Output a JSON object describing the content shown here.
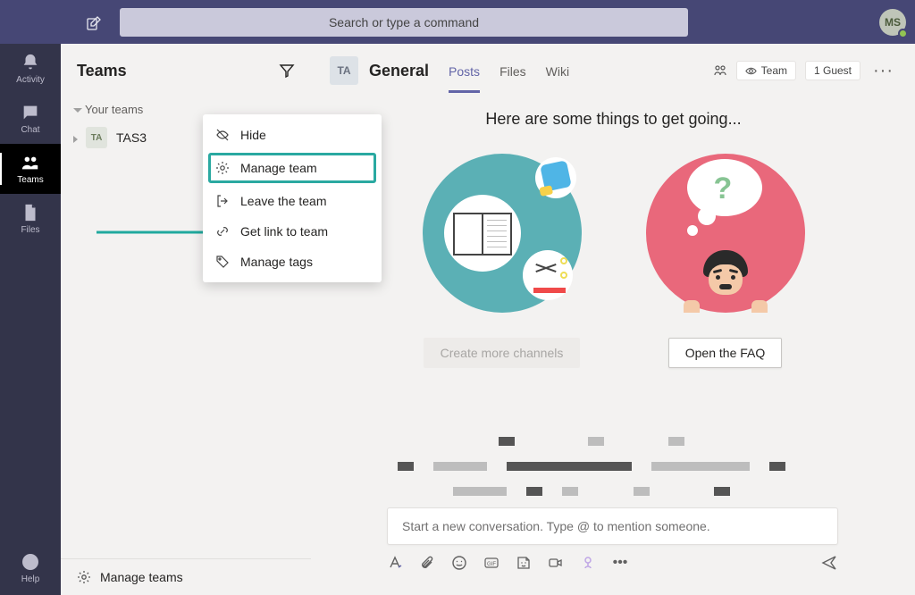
{
  "search": {
    "placeholder": "Search or type a command"
  },
  "user": {
    "initials": "MS"
  },
  "rail": {
    "activity": "Activity",
    "chat": "Chat",
    "teams": "Teams",
    "files": "Files",
    "help": "Help"
  },
  "teams_panel": {
    "title": "Teams",
    "group_label": "Your teams",
    "team": {
      "initials": "TA",
      "name": "TAS3"
    },
    "manage_teams": "Manage teams"
  },
  "context_menu": {
    "hide": "Hide",
    "manage_team": "Manage team",
    "leave": "Leave the team",
    "get_link": "Get link to team",
    "manage_tags": "Manage tags"
  },
  "channel": {
    "avatar": "TA",
    "name": "General",
    "tabs": {
      "posts": "Posts",
      "files": "Files",
      "wiki": "Wiki"
    },
    "visibility_label": "Team",
    "guest_label": "1 Guest"
  },
  "welcome": {
    "title": "Here are some things to get going...",
    "create_channels": "Create more channels",
    "open_faq": "Open the FAQ"
  },
  "composer": {
    "placeholder": "Start a new conversation. Type @ to mention someone."
  },
  "chart_data": null
}
